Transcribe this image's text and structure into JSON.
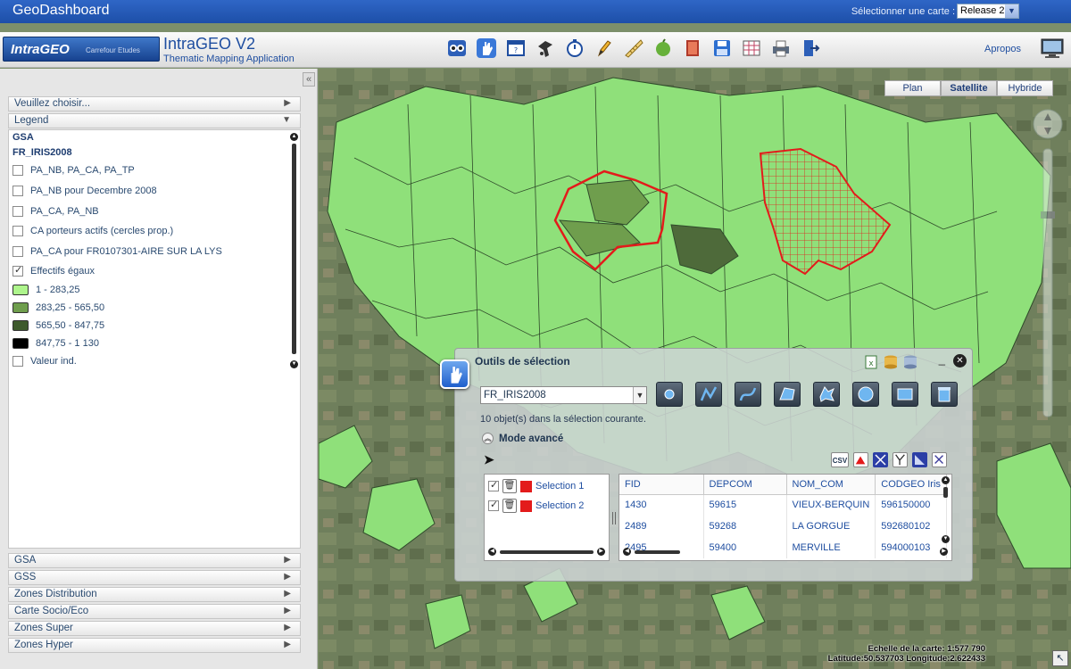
{
  "topbar": {
    "title": "GeoDashboard",
    "map_select_label": "Sélectionner une carte :",
    "map_select_value": "Release 2"
  },
  "app": {
    "logo_main": "IntraGEO",
    "logo_sub": "Carrefour Etudes",
    "title": "IntraGEO V2",
    "subtitle": "Thematic Mapping Application",
    "apropos": "Apropos",
    "toolbar_icons": [
      "glasses-icon",
      "hand-icon",
      "window-icon",
      "tool-icon",
      "timer-icon",
      "pencil-icon",
      "ruler-icon",
      "leaf-icon",
      "book-icon",
      "save-icon",
      "table-icon",
      "print-icon",
      "exit-icon"
    ]
  },
  "left": {
    "top_accordion": "Veuillez choisir...",
    "legend_header": "Legend",
    "gsa_head": "GSA",
    "layer_head": "FR_IRIS2008",
    "legend_items": [
      {
        "label": "PA_NB, PA_CA, PA_TP",
        "type": "checkbox",
        "checked": false
      },
      {
        "label": "PA_NB pour Decembre 2008",
        "type": "checkbox",
        "checked": false
      },
      {
        "label": "PA_CA, PA_NB",
        "type": "checkbox",
        "checked": false
      },
      {
        "label": "CA porteurs actifs (cercles prop.)",
        "type": "checkbox",
        "checked": false
      },
      {
        "label": "PA_CA pour FR0107301-AIRE SUR LA LYS",
        "type": "checkbox",
        "checked": false
      },
      {
        "label": "Effectifs égaux",
        "type": "checkbox",
        "checked": true
      },
      {
        "label": "1 - 283,25",
        "type": "swatch",
        "color": "#aef58c"
      },
      {
        "label": "283,25 - 565,50",
        "type": "swatch",
        "color": "#6f9e4d"
      },
      {
        "label": "565,50 - 847,75",
        "type": "swatch",
        "color": "#3e5a2c"
      },
      {
        "label": "847,75 - 1 130",
        "type": "swatch",
        "color": "#000000"
      },
      {
        "label": "Valeur ind.",
        "type": "checkbox",
        "checked": false
      }
    ],
    "bottom_accordions": [
      "GSA",
      "GSS",
      "Zones Distribution",
      "Carte Socio/Eco",
      "Zones Super",
      "Zones Hyper"
    ]
  },
  "map": {
    "map_types": [
      "Plan",
      "Satellite",
      "Hybride"
    ],
    "active_map_type": "Satellite",
    "scale_text": "Echelle de la carte: 1:577 790",
    "coords_text": "Latitude:50.537703   Longitude:2.622433",
    "colors": {
      "fill_light": "#8fe07a",
      "fill_mid": "#6f9e4d",
      "fill_dark": "#4e6a3a",
      "selection": "#e31b1b",
      "satellite": "#6f7f5c"
    }
  },
  "selection_dialog": {
    "title": "Outils de sélection",
    "layer": "FR_IRIS2008",
    "count_text": "10 objet(s) dans la sélection courante.",
    "advanced_mode": "Mode avancé",
    "export_csv": "CSV",
    "selections": [
      {
        "label": "Selection 1",
        "checked": true,
        "color": "#e31b1b"
      },
      {
        "label": "Selection 2",
        "checked": true,
        "color": "#e31b1b"
      }
    ],
    "table": {
      "columns": [
        "FID",
        "DEPCOM",
        "NOM_COM",
        "CODGEO Iris"
      ],
      "rows": [
        [
          "1430",
          "59615",
          "VIEUX-BERQUIN",
          "596150000"
        ],
        [
          "2489",
          "59268",
          "LA GORGUE",
          "592680102"
        ],
        [
          "2495",
          "59400",
          "MERVILLE",
          "594000103"
        ]
      ]
    },
    "tool_icons": [
      "point-icon",
      "polyline-icon",
      "curve-icon",
      "polygon-icon",
      "freehand-icon",
      "circle-icon",
      "rectangle-icon",
      "trash-icon"
    ]
  }
}
